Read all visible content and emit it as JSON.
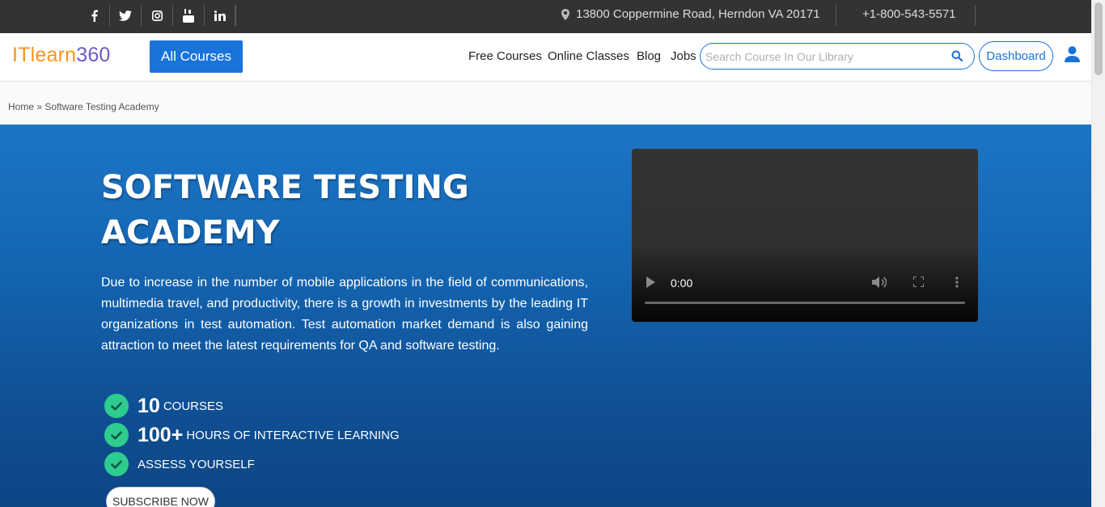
{
  "topbar": {
    "social": [
      "facebook-icon",
      "twitter-icon",
      "instagram-icon",
      "youtube-icon",
      "linkedin-icon"
    ],
    "address": "13800 Coppermine Road, Herndon VA 20171",
    "phone": "+1-800-543-5571"
  },
  "header": {
    "logo_part1": "ITlearn",
    "logo_part2": "360",
    "all_courses_label": "All Courses",
    "nav": [
      "Free Courses",
      "Online Classes",
      "Blog",
      "Jobs"
    ],
    "search_placeholder": "Search Course In Our Library",
    "search_value": "",
    "dashboard_label": "Dashboard"
  },
  "breadcrumb": {
    "home": "Home",
    "separator": "»",
    "current": "Software Testing Academy"
  },
  "hero": {
    "title_line1": "SOFTWARE TESTING",
    "title_line2": "ACADEMY",
    "description": "Due to increase in the number of mobile applications in the field of communications, multimedia travel, and productivity, there is a growth in investments by the leading IT organizations in test automation. Test automation market demand is also gaining attraction to meet the latest requirements for QA and software testing.",
    "features": [
      {
        "big": "10",
        "small": "Courses"
      },
      {
        "big": "100+",
        "small": "Hours of Interactive Learning"
      },
      {
        "big": "",
        "small": "Assess Yourself"
      }
    ],
    "subscribe_label": "Subscribe Now"
  },
  "video": {
    "time": "0:00",
    "progress": 0
  },
  "colors": {
    "accent": "#1a73d9",
    "logo_orange": "#f7941d",
    "logo_purple": "#6b5bc4",
    "check_green": "#2ecc8f",
    "topbar": "#333333"
  }
}
